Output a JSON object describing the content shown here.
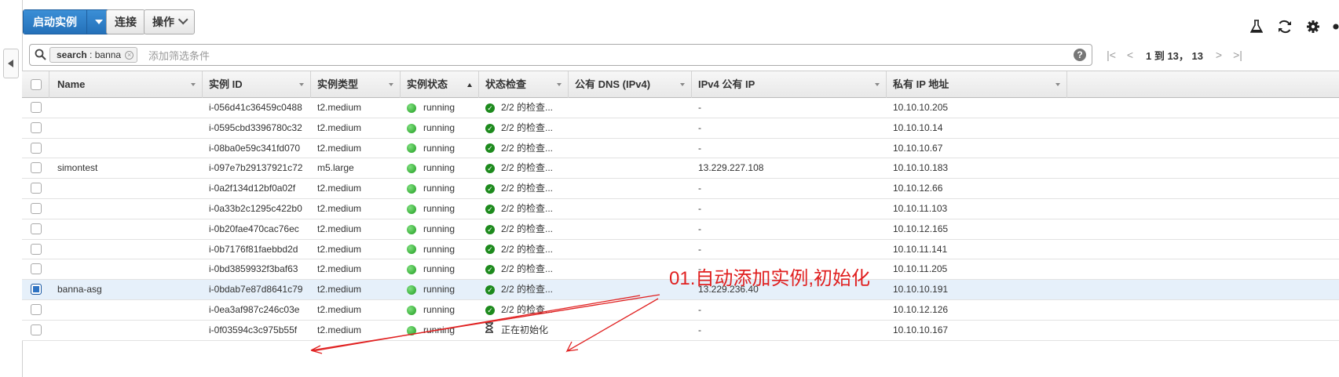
{
  "toolbar": {
    "launch_label": "启动实例",
    "connect_label": "连接",
    "actions_label": "操作"
  },
  "top_icons": [
    "flask-icon",
    "refresh-icon",
    "gear-icon",
    "help-icon"
  ],
  "filter": {
    "token_key": "search",
    "token_sep": " : ",
    "token_value": "banna",
    "placeholder": "添加筛选条件"
  },
  "pager": {
    "info": "1 到 13， 13"
  },
  "columns": [
    {
      "label": "Name"
    },
    {
      "label": "实例 ID"
    },
    {
      "label": "实例类型"
    },
    {
      "label": "实例状态"
    },
    {
      "label": "状态检查"
    },
    {
      "label": "公有 DNS (IPv4)"
    },
    {
      "label": "IPv4 公有 IP"
    },
    {
      "label": "私有 IP 地址"
    }
  ],
  "sorted_column": "实例状态",
  "rows": [
    {
      "name": "",
      "id": "i-056d41c36459c0488",
      "type": "t2.medium",
      "state": "running",
      "check": "2/2 的检查...",
      "check_kind": "ok",
      "dns": "",
      "public_ip": "-",
      "private_ip": "10.10.10.205",
      "selected": false
    },
    {
      "name": "",
      "id": "i-0595cbd3396780c32",
      "type": "t2.medium",
      "state": "running",
      "check": "2/2 的检查...",
      "check_kind": "ok",
      "dns": "",
      "public_ip": "-",
      "private_ip": "10.10.10.14",
      "selected": false
    },
    {
      "name": "",
      "id": "i-08ba0e59c341fd070",
      "type": "t2.medium",
      "state": "running",
      "check": "2/2 的检查...",
      "check_kind": "ok",
      "dns": "",
      "public_ip": "-",
      "private_ip": "10.10.10.67",
      "selected": false
    },
    {
      "name": "simontest",
      "id": "i-097e7b29137921c72",
      "type": "m5.large",
      "state": "running",
      "check": "2/2 的检查...",
      "check_kind": "ok",
      "dns": "",
      "public_ip": "13.229.227.108",
      "private_ip": "10.10.10.183",
      "selected": false
    },
    {
      "name": "",
      "id": "i-0a2f134d12bf0a02f",
      "type": "t2.medium",
      "state": "running",
      "check": "2/2 的检查...",
      "check_kind": "ok",
      "dns": "",
      "public_ip": "-",
      "private_ip": "10.10.12.66",
      "selected": false
    },
    {
      "name": "",
      "id": "i-0a33b2c1295c422b0",
      "type": "t2.medium",
      "state": "running",
      "check": "2/2 的检查...",
      "check_kind": "ok",
      "dns": "",
      "public_ip": "-",
      "private_ip": "10.10.11.103",
      "selected": false
    },
    {
      "name": "",
      "id": "i-0b20fae470cac76ec",
      "type": "t2.medium",
      "state": "running",
      "check": "2/2 的检查...",
      "check_kind": "ok",
      "dns": "",
      "public_ip": "-",
      "private_ip": "10.10.12.165",
      "selected": false
    },
    {
      "name": "",
      "id": "i-0b7176f81faebbd2d",
      "type": "t2.medium",
      "state": "running",
      "check": "2/2 的检查...",
      "check_kind": "ok",
      "dns": "",
      "public_ip": "-",
      "private_ip": "10.10.11.141",
      "selected": false
    },
    {
      "name": "",
      "id": "i-0bd3859932f3baf63",
      "type": "t2.medium",
      "state": "running",
      "check": "2/2 的检查...",
      "check_kind": "ok",
      "dns": "",
      "public_ip": "-",
      "private_ip": "10.10.11.205",
      "selected": false
    },
    {
      "name": "banna-asg",
      "id": "i-0bdab7e87d8641c79",
      "type": "t2.medium",
      "state": "running",
      "check": "2/2 的检查...",
      "check_kind": "ok",
      "dns": "",
      "public_ip": "13.229.236.40",
      "private_ip": "10.10.10.191",
      "selected": true
    },
    {
      "name": "",
      "id": "i-0ea3af987c246c03e",
      "type": "t2.medium",
      "state": "running",
      "check": "2/2 的检查...",
      "check_kind": "ok",
      "dns": "",
      "public_ip": "-",
      "private_ip": "10.10.12.126",
      "selected": false
    },
    {
      "name": "",
      "id": "i-0f03594c3c975b55f",
      "type": "t2.medium",
      "state": "running",
      "check": "正在初始化",
      "check_kind": "init",
      "dns": "",
      "public_ip": "-",
      "private_ip": "10.10.10.167",
      "selected": false
    }
  ],
  "annotation": {
    "text": "01.自动添加实例,初始化",
    "color": "#e02020"
  },
  "colors": {
    "primary_button": "#2471b9",
    "running": "#1f9b1f",
    "selected_row": "#e6f0fa",
    "annotation": "#e02020"
  }
}
